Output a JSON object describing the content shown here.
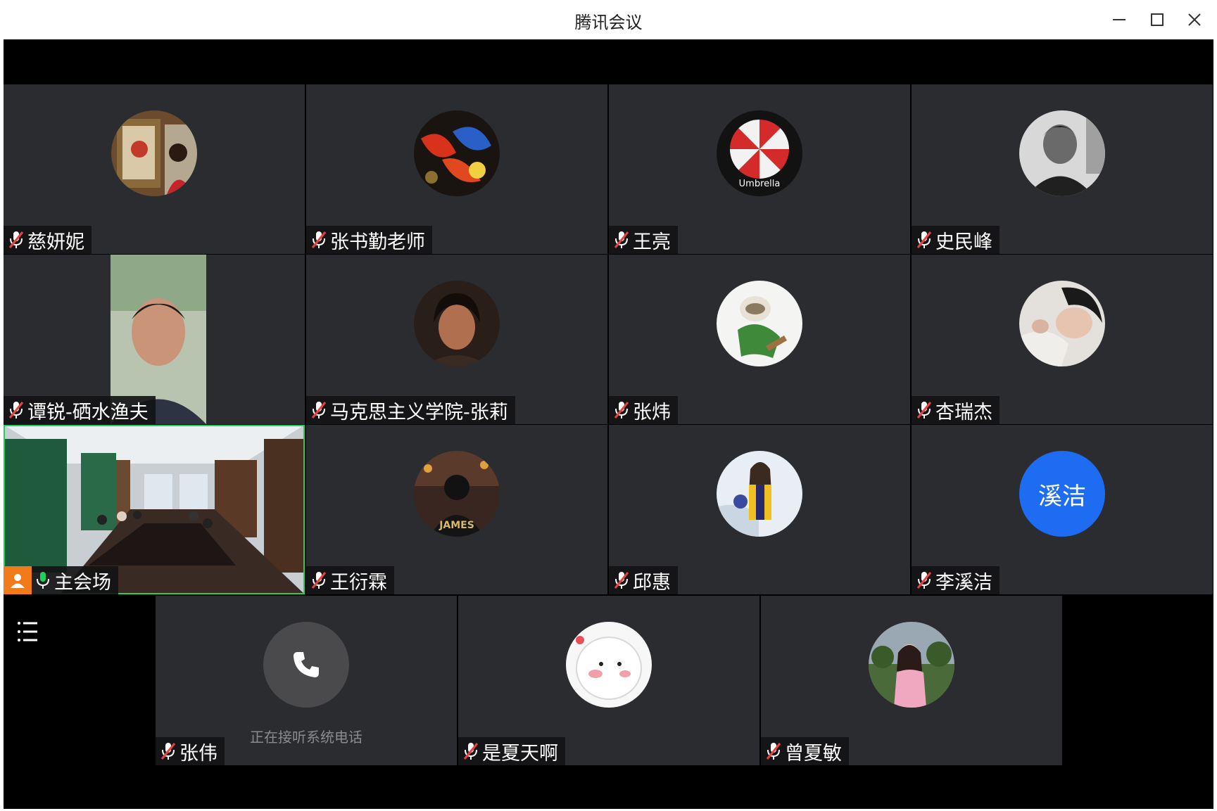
{
  "window": {
    "title": "腾讯会议"
  },
  "colors": {
    "active_border": "#1fd15b",
    "tile_bg": "#2b2c30",
    "host_badge": "#f17a1a",
    "initials_avatar": "#1e6cf2",
    "muted_mic": "#e8423f",
    "active_mic": "#1fd15b"
  },
  "participants": [
    {
      "name": "慈妍妮",
      "avatar": "photo-woman-painting",
      "mic": "muted"
    },
    {
      "name": "张书勤老师",
      "avatar": "photo-koi-fish",
      "mic": "muted"
    },
    {
      "name": "王亮",
      "avatar": "umbrella-logo",
      "avatar_text": "Umbrella",
      "mic": "muted"
    },
    {
      "name": "史民峰",
      "avatar": "photo-man-bw",
      "mic": "muted"
    },
    {
      "name": "谭锐-硒水渔夫",
      "avatar": "video-man",
      "mic": "muted"
    },
    {
      "name": "马克思主义学院-张莉",
      "avatar": "photo-woman-portrait",
      "mic": "muted"
    },
    {
      "name": "张炜",
      "avatar": "cartoon-master-shifu",
      "mic": "muted"
    },
    {
      "name": "杏瑞杰",
      "avatar": "photo-person-lying",
      "mic": "muted"
    },
    {
      "name": "主会场",
      "avatar": "video-conference-room",
      "mic": "active",
      "host": true
    },
    {
      "name": "王衍霖",
      "avatar": "photo-james-jersey",
      "avatar_text": "JAMES",
      "mic": "muted"
    },
    {
      "name": "邱惠",
      "avatar": "photo-girl-basketball",
      "mic": "muted"
    },
    {
      "name": "李溪洁",
      "avatar": "initials",
      "avatar_text": "溪洁",
      "mic": "muted"
    },
    {
      "name": "张伟",
      "avatar": "phone-call",
      "status": "正在接听系统电话",
      "mic": "muted"
    },
    {
      "name": "是夏天啊",
      "avatar": "cartoon-blush-face",
      "mic": "muted"
    },
    {
      "name": "曾夏敏",
      "avatar": "photo-girl-outdoor",
      "mic": "muted"
    }
  ]
}
